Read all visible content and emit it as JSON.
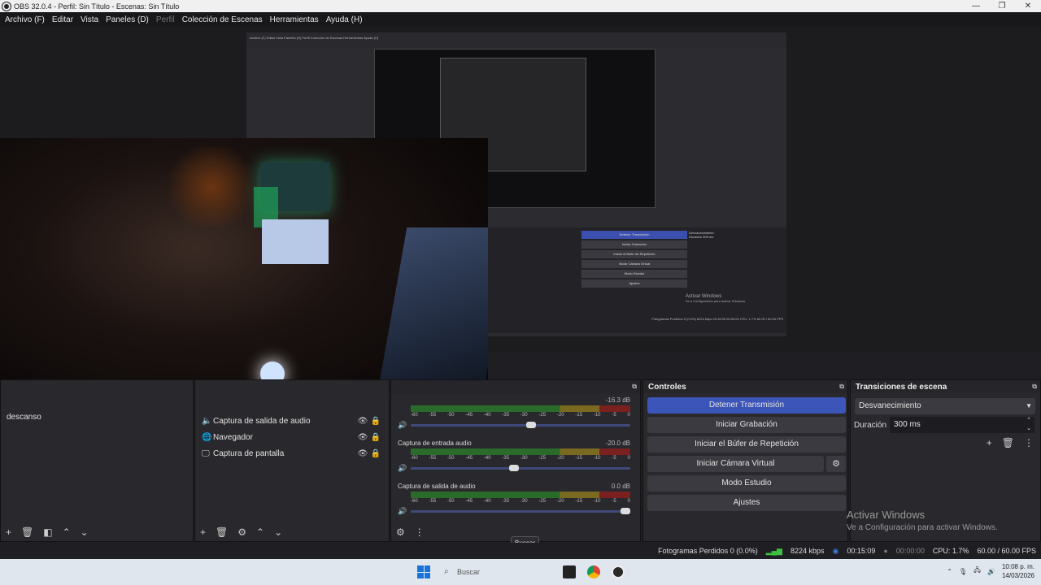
{
  "window": {
    "title": "OBS 32.0.4 - Perfil: Sin Título - Escenas: Sin Título",
    "minimize": "—",
    "maximize": "❐",
    "close": "✕"
  },
  "menu": {
    "items": [
      "Archivo (F)",
      "Editar",
      "Vista",
      "Paneles (D)",
      "Perfil",
      "Colección de Escenas",
      "Herramientas",
      "Ayuda (H)"
    ]
  },
  "preview": {
    "nested_menu": "Archivo (F)   Editar   Vista   Paneles (D)   Perfil   Colección de Escenas   Herramientas   Ayuda (H)",
    "nested_controls": [
      "Detener Transmisión",
      "Iniciar Grabación",
      "Iniciar el Búfer de Repetición",
      "Iniciar Cámara Virtual",
      "Modo Estudio",
      "Ajustes"
    ],
    "nested_transition": "Desvanecimiento",
    "nested_duration": "Duración   300 ms",
    "nested_activate_1": "Activar Windows",
    "nested_activate_2": "Ve a Configuración para activar Windows.",
    "nested_status": "Fotogramas Perdidos 0 (0.0%)   8224 kbps   00:15:09   00:00:00   CPU: 1.7%   60.00 / 60.00 FPS"
  },
  "scenes": {
    "items": [
      "descanso"
    ]
  },
  "sources": {
    "items": [
      {
        "label": "Captura de salida de audio",
        "icon": "speaker-icon"
      },
      {
        "label": "Navegador",
        "icon": "globe-icon"
      },
      {
        "label": "Captura de pantalla",
        "icon": "monitor-icon"
      }
    ]
  },
  "mixer": {
    "ticks": [
      "-60",
      "-55",
      "-50",
      "-45",
      "-40",
      "-35",
      "-30",
      "-25",
      "-20",
      "-15",
      "-10",
      "-5",
      "0"
    ],
    "channels": [
      {
        "name": "",
        "db": "-16.3 dB",
        "volume": 0.55
      },
      {
        "name": "Captura de entrada audio",
        "db": "-20.0 dB",
        "volume": 0.47
      },
      {
        "name": "Captura de salida de audio",
        "db": "0.0 dB",
        "volume": 1.0
      }
    ]
  },
  "controls": {
    "title": "Controles",
    "stop_stream": "Detener Transmisión",
    "start_recording": "Iniciar Grabación",
    "replay_buffer": "Iniciar el Búfer de Repetición",
    "virtual_camera": "Iniciar Cámara Virtual",
    "studio_mode": "Modo Estudio",
    "settings": "Ajustes"
  },
  "transitions": {
    "title": "Transiciones de escena",
    "selected": "Desvanecimiento",
    "duration_label": "Duración",
    "duration_value": "300 ms"
  },
  "activate_windows": {
    "line1": "Activar Windows",
    "line2": "Ve a Configuración para activar Windows."
  },
  "status": {
    "dropped_frames": "Fotogramas Perdidos 0 (0.0%)",
    "bitrate": "8224 kbps",
    "stream_time": "00:15:09",
    "rec_time": "00:00:00",
    "cpu": "CPU: 1.7%",
    "fps": "60.00 / 60.00 FPS"
  },
  "tooltip": "Buscar",
  "taskbar": {
    "search_placeholder": "Buscar",
    "time": "10:08 p. m.",
    "date": "14/03/2026"
  },
  "colors": {
    "accent": "#3c55b8",
    "panel_bg": "#29292d",
    "meter_green": "#2a6a2a",
    "meter_yellow": "#7a6a20",
    "meter_red": "#7a2020"
  }
}
